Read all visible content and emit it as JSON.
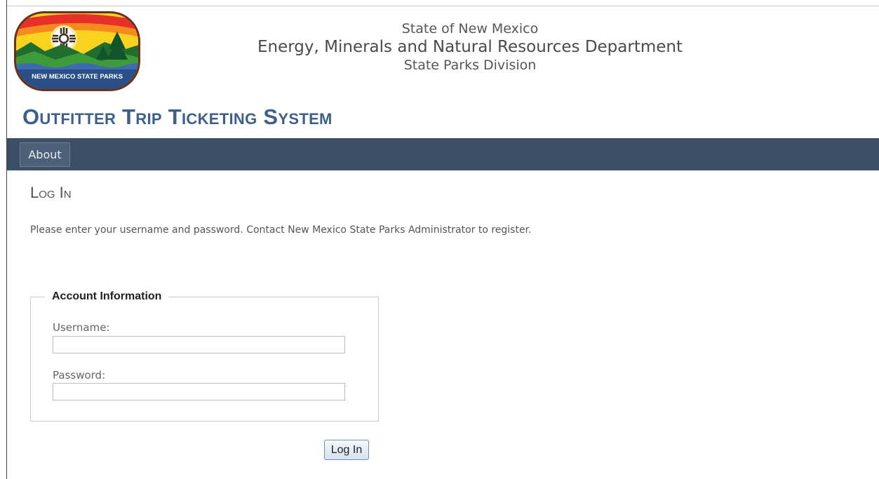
{
  "agency": {
    "line1": "State of New Mexico",
    "line2": "Energy, Minerals and Natural Resources Department",
    "line3": "State Parks Division"
  },
  "logo": {
    "text": "NEW MEXICO STATE PARKS",
    "colors": {
      "border": "#6b2f1a",
      "sun": "#f6a81c",
      "sky": "#d8451b",
      "hills": "#2f8a3a",
      "water": "#2a4f86"
    }
  },
  "system_title": "Outfitter Trip Ticketing System",
  "nav": {
    "items": [
      {
        "label": "About"
      }
    ]
  },
  "page": {
    "heading": "Log In",
    "instructions": "Please enter your username and password. Contact New Mexico State Parks Administrator to register."
  },
  "account": {
    "legend": "Account Information",
    "username_label": "Username:",
    "username_value": "",
    "password_label": "Password:",
    "password_value": ""
  },
  "login_button": "Log In",
  "colors": {
    "title": "#3c5f8e",
    "navbar": "#3b5066"
  }
}
